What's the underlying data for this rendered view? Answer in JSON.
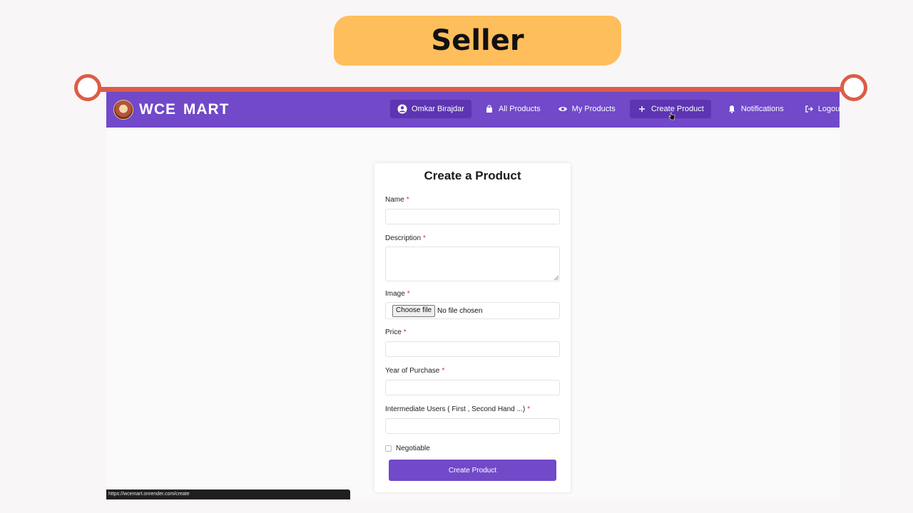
{
  "slide": {
    "title": "Seller"
  },
  "app": {
    "brand": {
      "name": "WCE  MART"
    },
    "nav": [
      {
        "label": "Omkar Birajdar",
        "icon": "user-circle-icon",
        "active": true
      },
      {
        "label": "All Products",
        "icon": "bag-icon",
        "active": false
      },
      {
        "label": "My Products",
        "icon": "eye-icon",
        "active": false
      },
      {
        "label": "Create Product",
        "icon": "plus-icon",
        "active": true
      },
      {
        "label": "Notifications",
        "icon": "bell-icon",
        "active": false
      },
      {
        "label": "Logout",
        "icon": "logout-icon",
        "active": false
      }
    ]
  },
  "form": {
    "heading": "Create a Product",
    "required_mark": "*",
    "fields": {
      "name": {
        "label": "Name",
        "value": ""
      },
      "description": {
        "label": "Description",
        "value": ""
      },
      "image": {
        "label": "Image",
        "button": "Choose file",
        "status": "No file chosen"
      },
      "price": {
        "label": "Price",
        "value": ""
      },
      "year": {
        "label": "Year of Purchase",
        "value": ""
      },
      "users": {
        "label": "Intermediate Users ( First , Second Hand ...)",
        "value": ""
      }
    },
    "negotiable": {
      "label": "Negotiable",
      "checked": false
    },
    "submit": "Create Product"
  },
  "status_url": "https://wcemart.onrender.com/create",
  "colors": {
    "primary": "#7149c9",
    "primary_dark": "#5d35b2",
    "accent_bar": "#dc5c48",
    "title_badge": "#ffbe5c",
    "required": "#d2323a"
  }
}
